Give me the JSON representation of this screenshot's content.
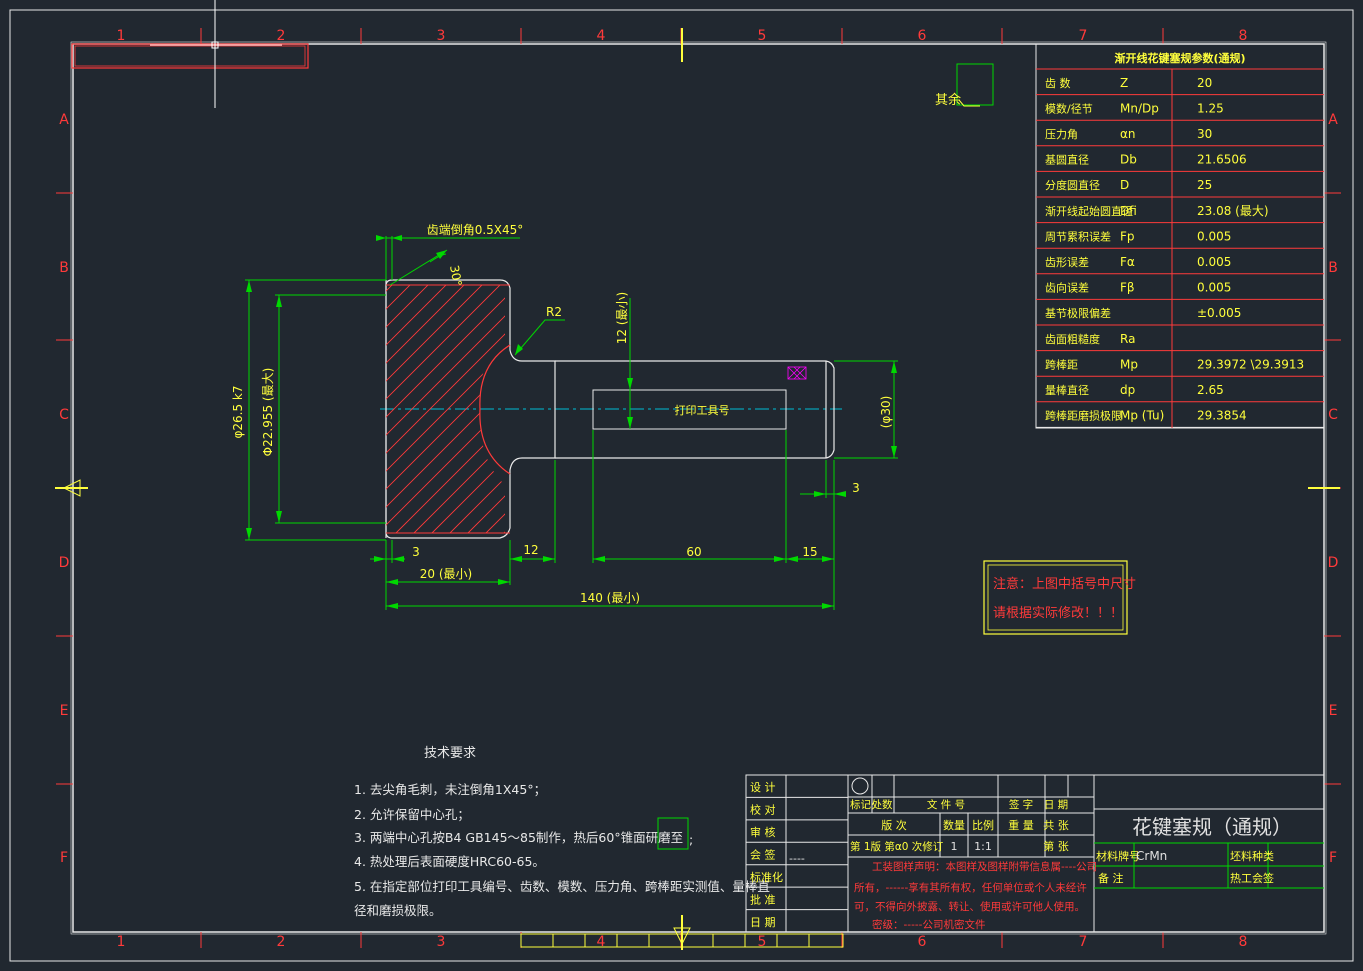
{
  "zone_numbers": [
    "1",
    "2",
    "3",
    "4",
    "5",
    "6",
    "7",
    "8"
  ],
  "zone_letters": [
    "A",
    "B",
    "C",
    "D",
    "E",
    "F"
  ],
  "surface_label": "其余",
  "param_table": {
    "title": "渐开线花键塞规参数(通规)",
    "rows": [
      {
        "name": "齿  数",
        "sym": "Z",
        "val": "20"
      },
      {
        "name": "模数/径节",
        "sym": "Mn/Dp",
        "val": "1.25"
      },
      {
        "name": "压力角",
        "sym": "αn",
        "val": "30"
      },
      {
        "name": "基圆直径",
        "sym": "Db",
        "val": "21.6506"
      },
      {
        "name": "分度圆直径",
        "sym": "D",
        "val": "25"
      },
      {
        "name": "渐开线起始圆直径",
        "sym": "Dfi",
        "val": "23.08 (最大)"
      },
      {
        "name": "周节累积误差",
        "sym": "Fp",
        "val": "0.005"
      },
      {
        "name": "齿形误差",
        "sym": "Fα",
        "val": "0.005"
      },
      {
        "name": "齿向误差",
        "sym": "Fβ",
        "val": "0.005"
      },
      {
        "name": "基节极限偏差",
        "sym": "",
        "val": "±0.005"
      },
      {
        "name": "齿面粗糙度",
        "sym": "Ra",
        "val": ""
      },
      {
        "name": "跨棒距",
        "sym": "Mp",
        "val": "29.3972 \\29.3913"
      },
      {
        "name": "量棒直径",
        "sym": "dp",
        "val": "2.65"
      },
      {
        "name": "跨棒距磨损极限",
        "sym": "Mp (Tu)",
        "val": "29.3854"
      }
    ]
  },
  "dims": {
    "chamfer": "齿端倒角0.5X45°",
    "angle30": "30°",
    "r2": "R2",
    "d265": "φ26.5 k7",
    "d22955": "Φ22.955 (最大)",
    "d30": "(φ30)",
    "d12": "12 (最小)",
    "print_label": "打印工具号",
    "d3a": "3",
    "d3b": "3",
    "d12b": "12",
    "d60": "60",
    "d15": "15",
    "d20": "20 (最小)",
    "d140": "140 (最小)"
  },
  "note": {
    "line1": "注意：上图中括号中尺寸",
    "line2": "请根据实际修改！！！"
  },
  "tech": {
    "title": "技术要求",
    "items": [
      "1. 去尖角毛刺，未注倒角1X45°；",
      "2. 允许保留中心孔；",
      "3. 两端中心孔按B4  GB145～85制作，热后60°锥面研磨至",
      "4. 热处理后表面硬度HRC60-65。",
      "5. 在指定部位打印工具编号、齿数、模数、压力角、跨棒距实测值、量棒直",
      "径和磨损极限。"
    ]
  },
  "title_block": {
    "left_labels": [
      "设  计",
      "校  对",
      "审  核",
      "会  签",
      "标准化",
      "批  准",
      "日  期"
    ],
    "countersign": "----",
    "hdr1": [
      "标记",
      "处数",
      "文 件 号",
      "签  字",
      "日  期"
    ],
    "hdr2": [
      "版   次",
      "数量",
      "比例",
      "重  量",
      "共  张"
    ],
    "row3": [
      "第 1版 第α0 次修订",
      "1",
      "1:1",
      "",
      "第  张"
    ],
    "drawing_name": "花键塞规（通规）",
    "material_label": "材料牌号",
    "material": "CrMn",
    "blank_label": "坯料种类",
    "remark_label": "备  注",
    "heat_label": "热工会签",
    "statement": [
      "工装图样声明：本图样及图样附带信息属----公司",
      "所有，------享有其所有权，任何单位或个人未经许",
      "可，不得向外披露、转让、使用或许可他人使用。",
      "密级：-----公司机密文件"
    ]
  }
}
